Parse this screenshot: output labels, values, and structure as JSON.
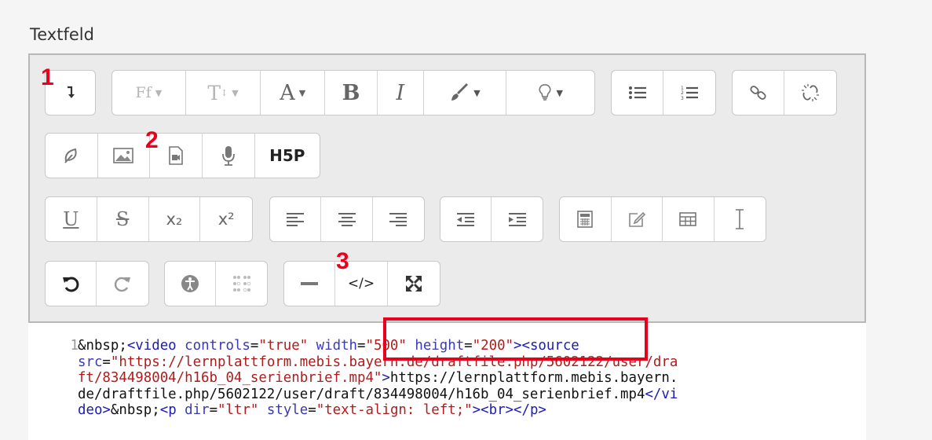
{
  "field_label": "Textfeld",
  "markers": [
    "1",
    "2",
    "3"
  ],
  "toolbar": {
    "row1": {
      "font_family": "Ff",
      "font_size": "T",
      "bold": "B",
      "italic": "I"
    },
    "row2": {
      "h5p": "H5P"
    },
    "row3": {
      "underline": "U",
      "strike": "S",
      "subscript": "x₂",
      "superscript": "x²"
    },
    "row4": {
      "code": "</>"
    }
  },
  "code": {
    "line_number": "1",
    "lines": [
      "&nbsp;<video controls=\"true\" width=\"500\" height=\"200\"><source",
      "src=\"https://lernplattform.mebis.bayern.de/draftfile.php/5602122/user/dra",
      "ft/834498004/h16b_04_serienbrief.mp4\">https://lernplattform.mebis.bayern.",
      "de/draftfile.php/5602122/user/draft/834498004/h16b_04_serienbrief.mp4</vi",
      "deo>&nbsp;<p dir=\"ltr\" style=\"text-align: left;\"><br></p>"
    ]
  },
  "colors": {
    "marker": "#e8001c",
    "highlight": "#e8001c"
  }
}
